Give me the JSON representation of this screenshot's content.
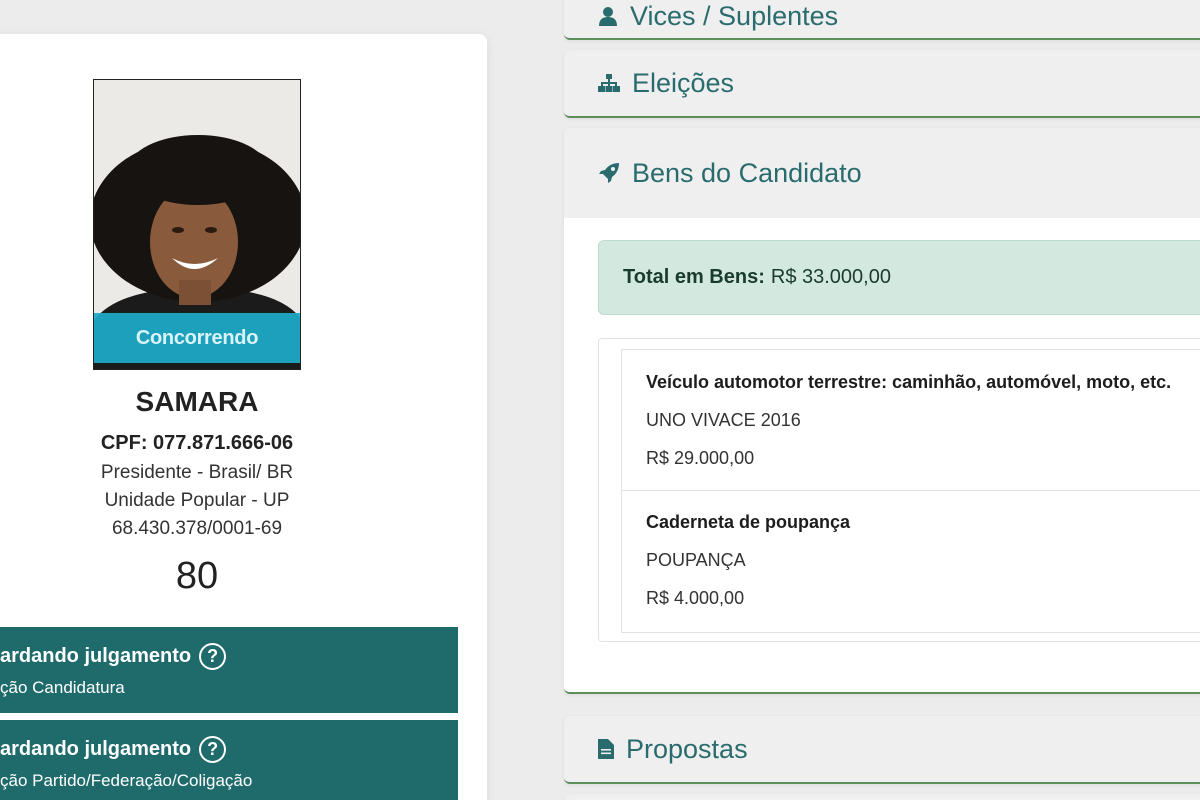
{
  "candidate": {
    "photo_badge": "Concorrendo",
    "name": "SAMARA",
    "cpf": "CPF: 077.871.666-06",
    "office": "Presidente - Brasil/ BR",
    "party": "Unidade Popular - UP",
    "cnpj": "68.430.378/0001-69",
    "number": "80",
    "statuses": [
      {
        "title": "ardando julgamento",
        "subtitle": "ção Candidatura"
      },
      {
        "title": "ardando julgamento",
        "subtitle": "ção Partido/Federação/Coligação"
      }
    ]
  },
  "panels": {
    "vices": {
      "title": "Vices / Suplentes",
      "icon": "user-icon"
    },
    "eleicoes": {
      "title": "Eleições",
      "icon": "sitemap-icon"
    },
    "bens": {
      "title": "Bens do Candidato",
      "icon": "rocket-icon",
      "total_label": "Total em Bens:",
      "total_value": "R$ 33.000,00",
      "items": [
        {
          "type": "Veículo automotor terrestre: caminhão, automóvel, moto, etc.",
          "description": "UNO VIVACE 2016",
          "value": "R$ 29.000,00"
        },
        {
          "type": "Caderneta de poupança",
          "description": "POUPANÇA",
          "value": "R$ 4.000,00"
        }
      ]
    },
    "propostas": {
      "title": "Propostas",
      "icon": "file-icon"
    }
  },
  "colors": {
    "header_text": "#2a6c6e",
    "status_bg": "#1f6b6c",
    "badge": "#1caac8",
    "total_bg": "#d3e8df"
  }
}
